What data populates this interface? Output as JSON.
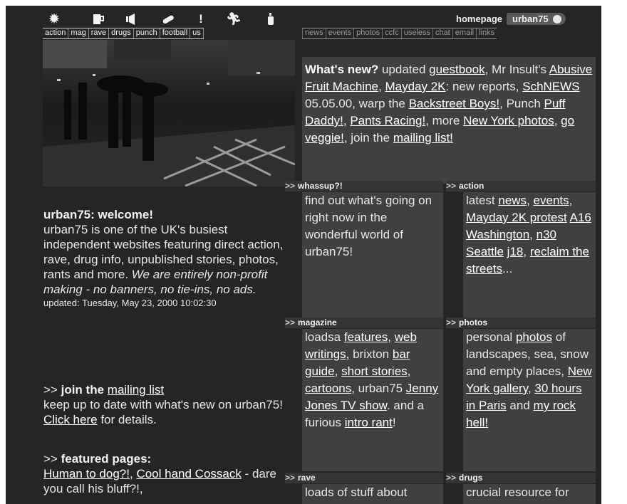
{
  "nav": {
    "icons": [
      "sun-icon",
      "mug-icon",
      "speaker-icon",
      "pill-icon",
      "exclamation-icon",
      "runner-icon",
      "bottle-icon"
    ],
    "items": [
      "action",
      "mag",
      "rave",
      "drugs",
      "punch",
      "football",
      "us"
    ]
  },
  "home": {
    "homepage_label": "homepage",
    "tab_label": "urban75"
  },
  "subnav": {
    "items": [
      "news",
      "events",
      "photos",
      "ccfc",
      "useless",
      "chat",
      "email",
      "links"
    ]
  },
  "welcome": {
    "title": "urban75: welcome!",
    "body": "urban75 is one of the UK's busiest independent websites featuring direct action, rave, drug info, unpublished stories, photos, rants and more.",
    "emphasis": "We are entirely non-profit making - no banners, no tie-ins, no ads.",
    "updated": "updated: Tuesday, May 23, 2000 10:02:30"
  },
  "mailing": {
    "arrow": ">>",
    "label": "join the",
    "link": "mailing list",
    "text_1": "keep up to date with what's new on urban75!",
    "link_2": "Click here",
    "text_2": "for details."
  },
  "featured": {
    "arrow": ">>",
    "label": "featured pages:",
    "link_1": "Human to dog?!",
    "sep": ",",
    "link_2": "Cool hand Cossack",
    "text": "- dare you call his bluff?!,"
  },
  "whatsnew": {
    "title": "What's new?",
    "t1": "updated",
    "l1": "guestbook",
    "t2": ", Mr Insult's",
    "l2": "Abusive Fruit Machine",
    "t3": ",",
    "l3": "Mayday 2K",
    "t4": ": new reports,",
    "l4": "SchNEWS",
    "t5": "05.05.00, warp the",
    "l5": "Backstreet Boys!",
    "t6": ", Punch",
    "l6": "Puff Daddy!",
    "t7": ",",
    "l7": "Pants Racing!",
    "t8": ", more",
    "l8": "New York photos",
    "t9": ",",
    "l9": "go veggie!",
    "t10": ", join the",
    "l10": "mailing list!"
  },
  "sections": {
    "whassup": {
      "arrow": ">>",
      "title": "whassup?!",
      "text": "find out what's going on right now in the wonderful world of urban75!"
    },
    "action": {
      "arrow": ">>",
      "title": "action",
      "t1": "latest",
      "l1": "news",
      "t2": ",",
      "l2": "events",
      "t3": ",",
      "l3": "Mayday 2K protest",
      "l4": "A16 Washington",
      "t4": ",",
      "l5": "n30 Seattle",
      "l6": "j18",
      "t5": ",",
      "l7": "reclaim the streets",
      "t6": "..."
    },
    "magazine": {
      "arrow": ">>",
      "title": "magazine",
      "t1": "loadsa",
      "l1": "features",
      "t2": ",",
      "l2": "web writings,",
      "t3": "brixton",
      "l3": "bar guide",
      "t4": ",",
      "l4": "short stories",
      "t5": ",",
      "l5": "cartoons",
      "t6": ", urban75",
      "l6": "Jenny Jones TV show",
      "t7": ". and a furious",
      "l7": "intro rant",
      "t8": "!"
    },
    "photos": {
      "arrow": ">>",
      "title": "photos",
      "t1": "personal",
      "l1": "photos",
      "t2": "of landscapes, sea, snow and empty places,",
      "l2": "New York gallery",
      "t3": ",",
      "l3": "30 hours in Paris",
      "t4": "and",
      "l4": "my rock hell!"
    },
    "rave": {
      "arrow": ">>",
      "title": "rave",
      "text": "loads of stuff about"
    },
    "drugs": {
      "arrow": ">>",
      "title": "drugs",
      "text": "crucial resource for"
    }
  }
}
